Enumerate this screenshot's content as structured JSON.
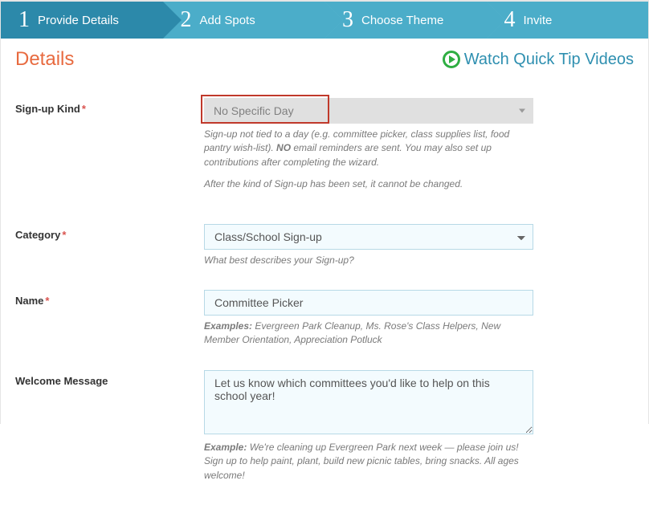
{
  "wizard": {
    "steps": [
      {
        "num": "1",
        "label": "Provide Details"
      },
      {
        "num": "2",
        "label": "Add Spots"
      },
      {
        "num": "3",
        "label": "Choose Theme"
      },
      {
        "num": "4",
        "label": "Invite"
      }
    ]
  },
  "section_title": "Details",
  "quick_tip_link": "Watch Quick Tip Videos",
  "fields": {
    "kind": {
      "label": "Sign-up Kind",
      "value": "No Specific Day",
      "hint1_a": "Sign-up not tied to a day (e.g. committee picker, class supplies list, food pantry wish-list). ",
      "hint1_b": "NO",
      "hint1_c": " email reminders are sent. You may also set up contributions after completing the wizard.",
      "hint2": "After the kind of Sign-up has been set, it cannot be changed."
    },
    "category": {
      "label": "Category",
      "value": "Class/School Sign-up",
      "hint": "What best describes your Sign-up?"
    },
    "name": {
      "label": "Name",
      "value": "Committee Picker",
      "hint_lead": "Examples:",
      "hint": " Evergreen Park Cleanup, Ms. Rose's Class Helpers, New Member Orientation, Appreciation Potluck"
    },
    "welcome": {
      "label": "Welcome Message",
      "value": "Let us know which committees you'd like to help on this school year!",
      "hint_lead": "Example:",
      "hint": " We're cleaning up Evergreen Park next week — please join us! Sign up to help paint, plant, build new picnic tables, bring snacks. All ages welcome!"
    }
  }
}
